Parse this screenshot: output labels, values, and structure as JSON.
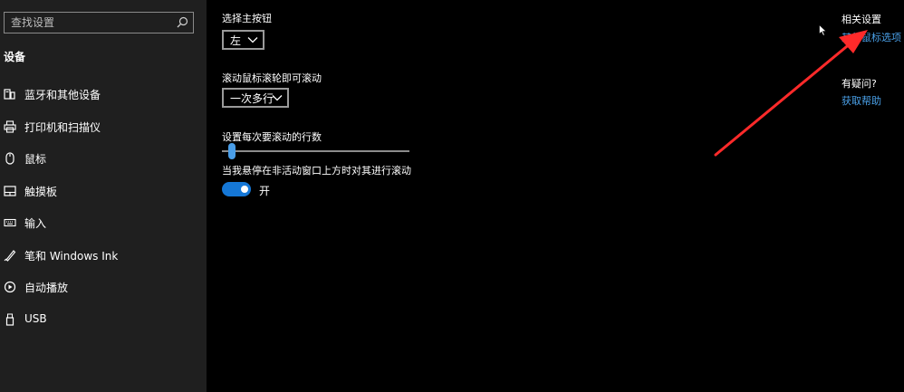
{
  "sidebar": {
    "search_placeholder": "查找设置",
    "section_title": "设备",
    "items": [
      {
        "label": "蓝牙和其他设备",
        "icon": "bluetooth-devices-icon"
      },
      {
        "label": "打印机和扫描仪",
        "icon": "printer-icon"
      },
      {
        "label": "鼠标",
        "icon": "mouse-icon"
      },
      {
        "label": "触摸板",
        "icon": "touchpad-icon"
      },
      {
        "label": "输入",
        "icon": "keyboard-icon"
      },
      {
        "label": "笔和 Windows Ink",
        "icon": "pen-icon"
      },
      {
        "label": "自动播放",
        "icon": "autoplay-icon"
      },
      {
        "label": "USB",
        "icon": "usb-icon"
      }
    ]
  },
  "main": {
    "primary_button_label": "选择主按钮",
    "primary_button_value": "左",
    "scroll_label": "滚动鼠标滚轮即可滚动",
    "scroll_value": "一次多行",
    "lines_label": "设置每次要滚动的行数",
    "lines_level": 0.02,
    "inactive_scroll_label": "当我悬停在非活动窗口上方时对其进行滚动",
    "inactive_scroll_state": "开",
    "inactive_scroll_on": true
  },
  "right": {
    "related_title": "相关设置",
    "related_link": "其他鼠标选项",
    "help_title": "有疑问?",
    "help_link": "获取帮助"
  },
  "colors": {
    "accent": "#1577d6",
    "link": "#4aa0e8",
    "arrow": "#ff2a2a"
  }
}
